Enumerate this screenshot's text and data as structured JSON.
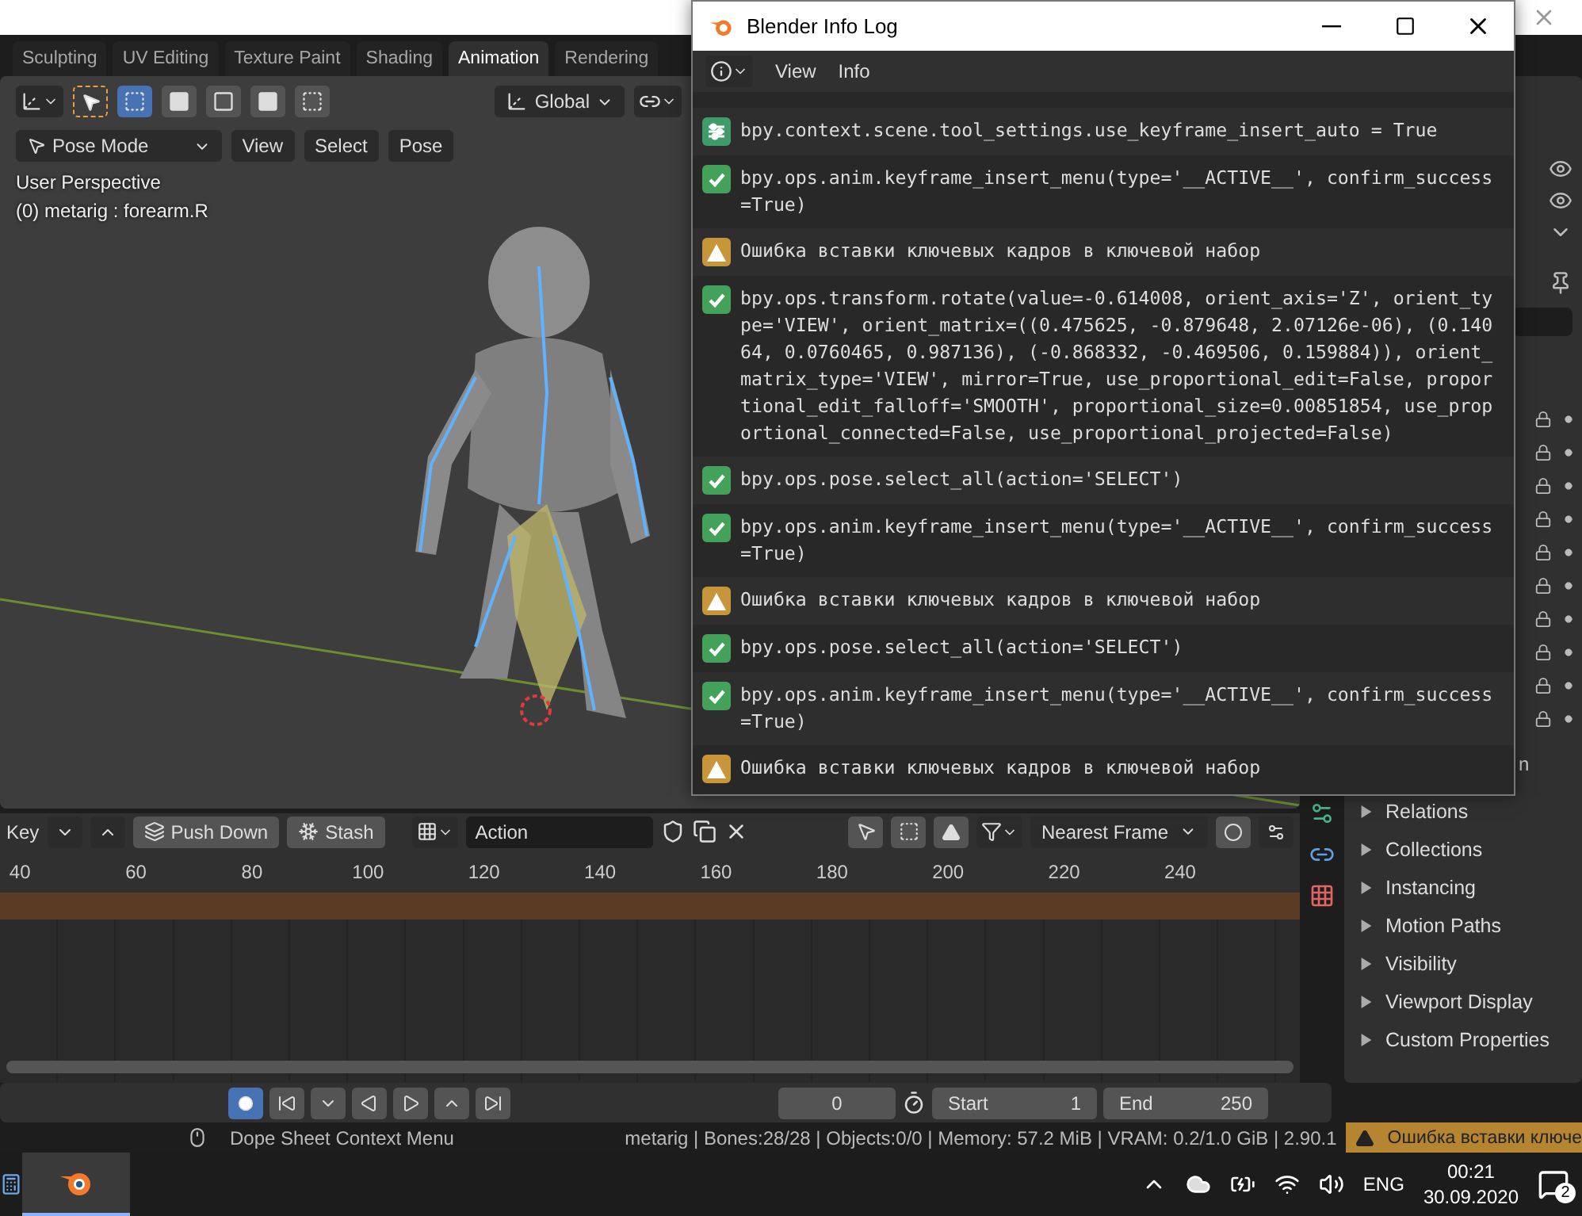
{
  "workspace_tabs": [
    {
      "label": "Sculpting",
      "selected": false
    },
    {
      "label": "UV Editing",
      "selected": false
    },
    {
      "label": "Texture Paint",
      "selected": false
    },
    {
      "label": "Shading",
      "selected": false
    },
    {
      "label": "Animation",
      "selected": true
    },
    {
      "label": "Rendering",
      "selected": false
    }
  ],
  "viewport": {
    "orientation": "Global",
    "mode": "Pose Mode",
    "menus": [
      "View",
      "Select",
      "Pose"
    ],
    "overlay": [
      "User Perspective",
      "(0) metarig : forearm.R"
    ]
  },
  "info_log": {
    "title": "Blender Info Log",
    "menus": [
      "View",
      "Info"
    ],
    "entries": [
      {
        "kind": "property",
        "text": "bpy.context.scene.tool_settings.use_keyframe_insert_auto = True"
      },
      {
        "kind": "success",
        "text": "bpy.ops.anim.keyframe_insert_menu(type='__ACTIVE__', confirm_success=True)"
      },
      {
        "kind": "warning",
        "text": "Ошибка вставки ключевых кадров в ключевой набор"
      },
      {
        "kind": "success",
        "text": "bpy.ops.transform.rotate(value=-0.614008, orient_axis='Z', orient_type='VIEW', orient_matrix=((0.475625, -0.879648, 2.07126e-06), (0.14064, 0.0760465, 0.987136), (-0.868332, -0.469506, 0.159884)), orient_matrix_type='VIEW', mirror=True, use_proportional_edit=False, proportional_edit_falloff='SMOOTH', proportional_size=0.00851854, use_proportional_connected=False, use_proportional_projected=False)"
      },
      {
        "kind": "success",
        "text": "bpy.ops.pose.select_all(action='SELECT')"
      },
      {
        "kind": "success",
        "text": "bpy.ops.anim.keyframe_insert_menu(type='__ACTIVE__', confirm_success=True)"
      },
      {
        "kind": "warning",
        "text": "Ошибка вставки ключевых кадров в ключевой набор"
      },
      {
        "kind": "success",
        "text": "bpy.ops.pose.select_all(action='SELECT')"
      },
      {
        "kind": "success",
        "text": "bpy.ops.anim.keyframe_insert_menu(type='__ACTIVE__', confirm_success=True)"
      },
      {
        "kind": "warning",
        "text": "Ошибка вставки ключевых кадров в ключевой набор"
      }
    ]
  },
  "properties": {
    "partial_heading": "n",
    "panels": [
      {
        "label": "Relations",
        "expanded": false
      },
      {
        "label": "Collections",
        "expanded": false
      },
      {
        "label": "Instancing",
        "expanded": false
      },
      {
        "label": "Motion Paths",
        "expanded": false
      },
      {
        "label": "Visibility",
        "expanded": false
      },
      {
        "label": "Viewport Display",
        "expanded": false
      },
      {
        "label": "Custom Properties",
        "expanded": false
      }
    ]
  },
  "dope_sheet": {
    "mode": "Key",
    "buttons": [
      "Push Down",
      "Stash"
    ],
    "action": "Action",
    "snapping": "Nearest Frame",
    "ruler": [
      "40",
      "60",
      "80",
      "100",
      "120",
      "140",
      "160",
      "180",
      "200",
      "220",
      "240"
    ]
  },
  "playback": {
    "current_frame": "0",
    "start_label": "Start",
    "start": "1",
    "end_label": "End",
    "end": "250"
  },
  "status_bar": {
    "hint": "Dope Sheet Context Menu",
    "stats": "metarig | Bones:28/28 | Objects:0/0 | Memory: 57.2 MiB | VRAM: 0.2/1.0 GiB | 2.90.1",
    "warning": "Ошибка вставки ключе"
  },
  "taskbar": {
    "language": "ENG",
    "time": "00:21",
    "date": "30.09.2020",
    "notifications": "2"
  }
}
